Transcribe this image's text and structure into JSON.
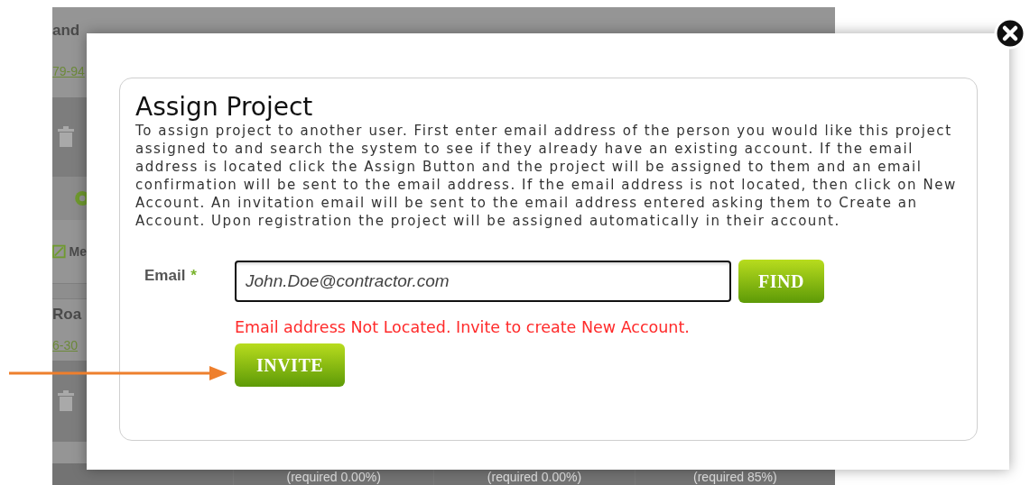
{
  "background_page": {
    "rows": [
      {
        "kind": "title",
        "text": "and"
      },
      {
        "kind": "link",
        "text": "79-94"
      },
      {
        "kind": "trash"
      },
      {
        "kind": "gear"
      },
      {
        "kind": "edit",
        "text": "Me"
      },
      {
        "kind": "divider"
      },
      {
        "kind": "title",
        "text": "Roa"
      },
      {
        "kind": "link",
        "text": "6-30"
      },
      {
        "kind": "trash"
      }
    ],
    "footer_cells": [
      "(required 0.00%)",
      "(required 0.00%)",
      "(required 85%)"
    ]
  },
  "dialog": {
    "title": "Assign Project",
    "description": "To assign project to another user. First enter email address of the person you would like this project assigned to and search the system to see if they already have an existing account. If the email address is located click the Assign Button and the project will be assigned to them and an email confirmation will be sent to the email address. If the email address is not located, then click on New Account. An invitation email will be sent to the email address entered asking them to Create an Account. Upon registration the project will be assigned automatically in their account.",
    "email_label": "Email",
    "required_mark": "*",
    "email_value": "John.Doe@contractor.com",
    "find_button": "FIND",
    "error": "Email address Not Located. Invite to create New Account.",
    "invite_button": "INVITE"
  }
}
